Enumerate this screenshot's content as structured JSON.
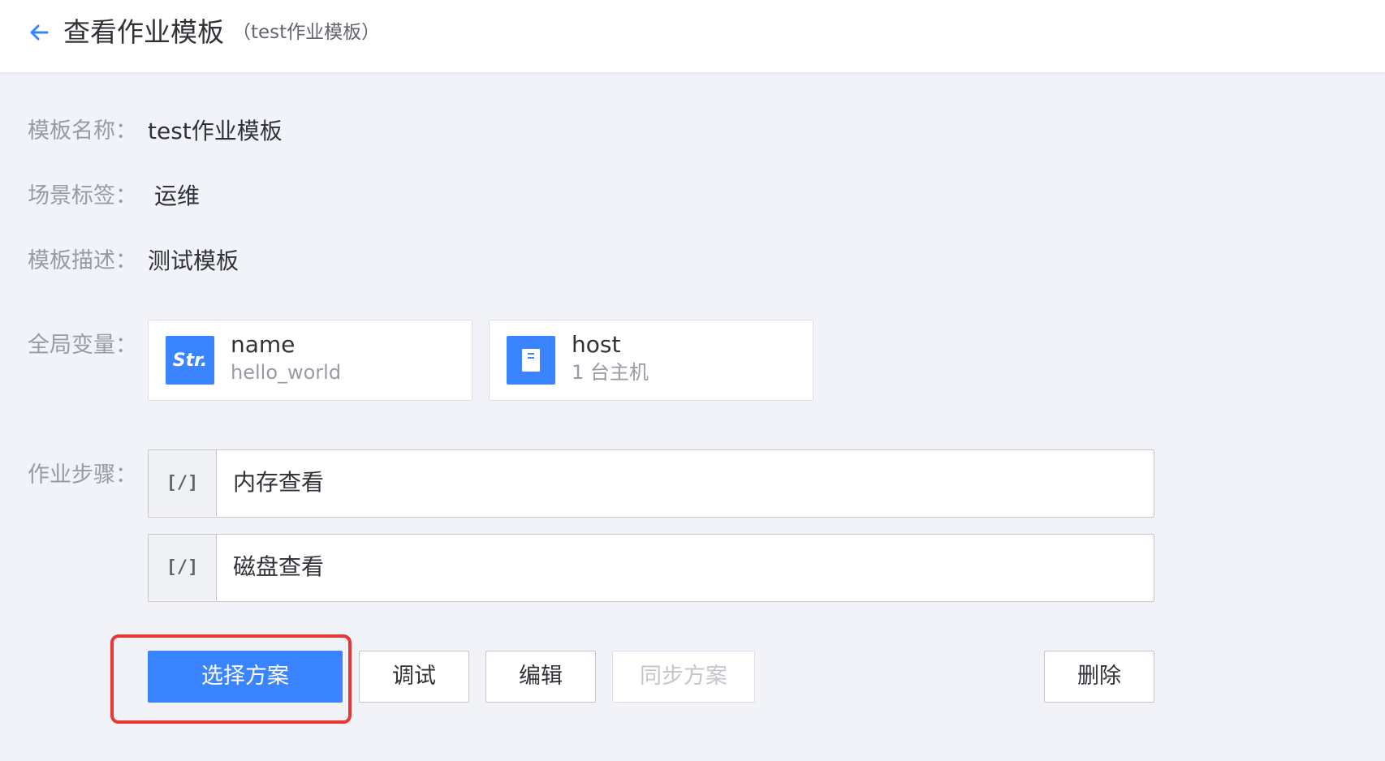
{
  "header": {
    "title": "查看作业模板",
    "subtitle": "（test作业模板）",
    "back_icon": "arrow-left-icon"
  },
  "info": {
    "name_label": "模板名称：",
    "name_value": "test作业模板",
    "tag_label": "场景标签：",
    "tag_value": "运维",
    "desc_label": "模板描述：",
    "desc_value": "测试模板"
  },
  "variables": {
    "label": "全局变量：",
    "items": [
      {
        "icon": "str-icon",
        "icon_text": "Str.",
        "name": "name",
        "desc": "hello_world"
      },
      {
        "icon": "host-icon",
        "name": "host",
        "desc": "1 台主机"
      }
    ]
  },
  "steps": {
    "label": "作业步骤：",
    "items": [
      {
        "icon": "script-icon",
        "icon_text": "[/]",
        "name": "内存查看"
      },
      {
        "icon": "script-icon",
        "icon_text": "[/]",
        "name": "磁盘查看"
      }
    ]
  },
  "actions": {
    "select_plan": "选择方案",
    "debug": "调试",
    "edit": "编辑",
    "sync_plan": "同步方案",
    "delete": "删除"
  },
  "colors": {
    "primary": "#3a84ff",
    "highlight": "#ea3636",
    "background": "#f1f3f8"
  }
}
